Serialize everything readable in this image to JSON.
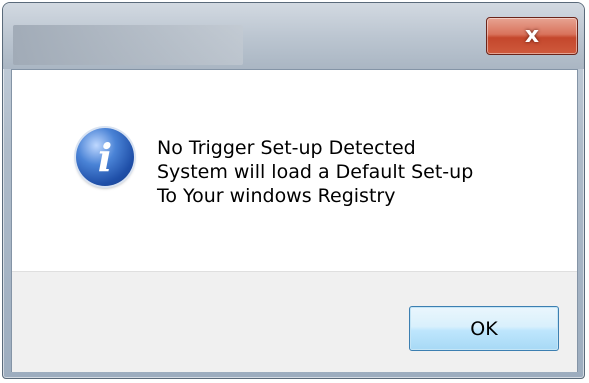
{
  "window": {
    "close_button_label": "x"
  },
  "dialog": {
    "icon": "info-icon",
    "message_lines": [
      "No Trigger Set-up Detected",
      "System will load a Default Set-up",
      "To Your windows Registry"
    ],
    "ok_button_label": "OK"
  },
  "colors": {
    "close_button": "#c4472c",
    "info_icon": "#1f4fa8",
    "ok_button_border": "#3c7fb1",
    "footer_background": "#f0f0f0"
  }
}
